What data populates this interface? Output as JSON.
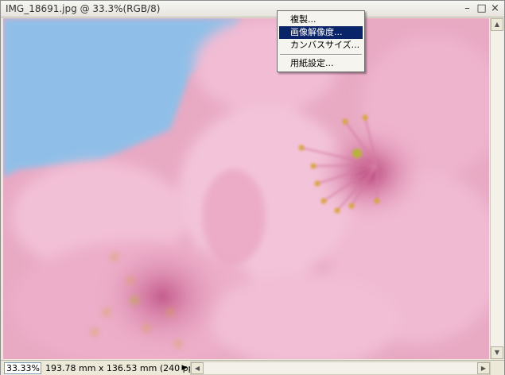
{
  "window": {
    "title": "IMG_18691.jpg @ 33.3%(RGB/8)",
    "minimize_glyph": "–",
    "maximize_glyph": "□",
    "close_glyph": "×"
  },
  "context_menu": {
    "items": [
      {
        "label": "複製..."
      },
      {
        "label": "画像解像度..."
      },
      {
        "label": "カンバスサイズ..."
      },
      {
        "label": "用紙設定..."
      }
    ],
    "selected_index": 1
  },
  "status": {
    "zoom": "33.33%",
    "doc_info": "193.78 mm x 136.53 mm (240 ppi)",
    "arrow_glyph": "▶"
  },
  "scroll": {
    "up_glyph": "▲",
    "down_glyph": "▼",
    "left_glyph": "◀",
    "right_glyph": "▶"
  },
  "image": {
    "subject": "pink cherry blossom close-up",
    "colors": {
      "sky": "#8fbfe8",
      "petal_light": "#f4c6da",
      "petal_mid": "#e79cbd",
      "petal_dark": "#c8628f",
      "stamen": "#d8a640"
    }
  }
}
